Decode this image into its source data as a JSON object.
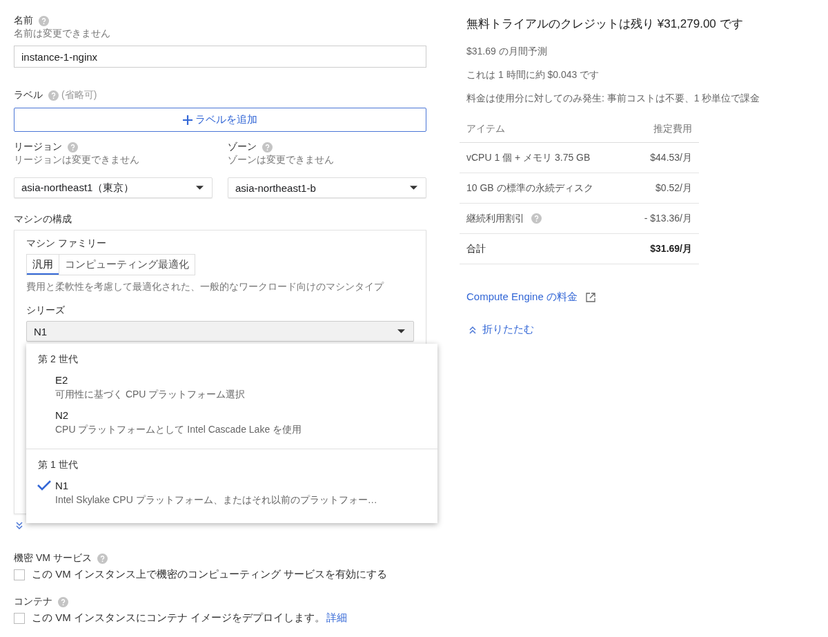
{
  "name_field": {
    "label": "名前",
    "hint": "名前は変更できません",
    "value": "instance-1-nginx"
  },
  "labels": {
    "label": "ラベル",
    "optional": "(省略可)",
    "add_button": "ラベルを追加"
  },
  "region": {
    "label": "リージョン",
    "hint": "リージョンは変更できません",
    "value": "asia-northeast1（東京）"
  },
  "zone": {
    "label": "ゾーン",
    "hint": "ゾーンは変更できません",
    "value": "asia-northeast1-b"
  },
  "machine_config": {
    "title": "マシンの構成",
    "family_label": "マシン ファミリー",
    "family_tabs": [
      {
        "label": "汎用",
        "selected": true
      },
      {
        "label": "コンピューティング最適化",
        "selected": false
      }
    ],
    "family_description": "費用と柔軟性を考慮して最適化された、一般的なワークロード向けのマシンタイプ",
    "series_label": "シリーズ",
    "series_value": "N1"
  },
  "series_menu": {
    "groups": [
      {
        "title": "第 2 世代",
        "options": [
          {
            "name": "E2",
            "description": "可用性に基づく CPU プラットフォーム選択",
            "selected": false
          },
          {
            "name": "N2",
            "description": "CPU プラットフォームとして Intel Cascade Lake を使用",
            "selected": false
          }
        ]
      },
      {
        "title": "第 1 世代",
        "options": [
          {
            "name": "N1",
            "description": "Intel Skylake CPU プラットフォーム、またはそれ以前のプラットフォー…",
            "selected": true
          }
        ]
      }
    ]
  },
  "confidential_vm": {
    "label": "機密 VM サービス",
    "checkbox_label": "この VM インスタンス上で機密のコンピューティング サービスを有効にする",
    "checked": false
  },
  "container": {
    "label": "コンテナ",
    "checkbox_label": "この VM インスタンスにコンテナ イメージをデプロイします。",
    "link": "詳細",
    "checked": false
  },
  "pricing": {
    "title": "無料トライアルのクレジットは残り ¥31,279.00 です",
    "monthly_estimate": "$31.69 の月間予測",
    "hourly": "これは 1 時間に約 $0.043 です",
    "billing_note": "料金は使用分に対してのみ発生: 事前コストは不要、1 秒単位で課金",
    "table": {
      "columns": [
        "アイテム",
        "推定費用"
      ],
      "rows": [
        {
          "kind": "item",
          "item": "vCPU 1 個 + メモリ 3.75 GB",
          "cost": "$44.53/月",
          "help": false
        },
        {
          "kind": "item",
          "item": "10 GB の標準の永続ディスク",
          "cost": "$0.52/月",
          "help": false
        },
        {
          "kind": "item",
          "item": "継続利用割引",
          "cost": "- $13.36/月",
          "help": true
        },
        {
          "kind": "total",
          "item": "合計",
          "cost": "$31.69/月",
          "help": false
        }
      ]
    },
    "pricing_link": "Compute Engine の料金",
    "collapse_link": "折りたたむ"
  }
}
